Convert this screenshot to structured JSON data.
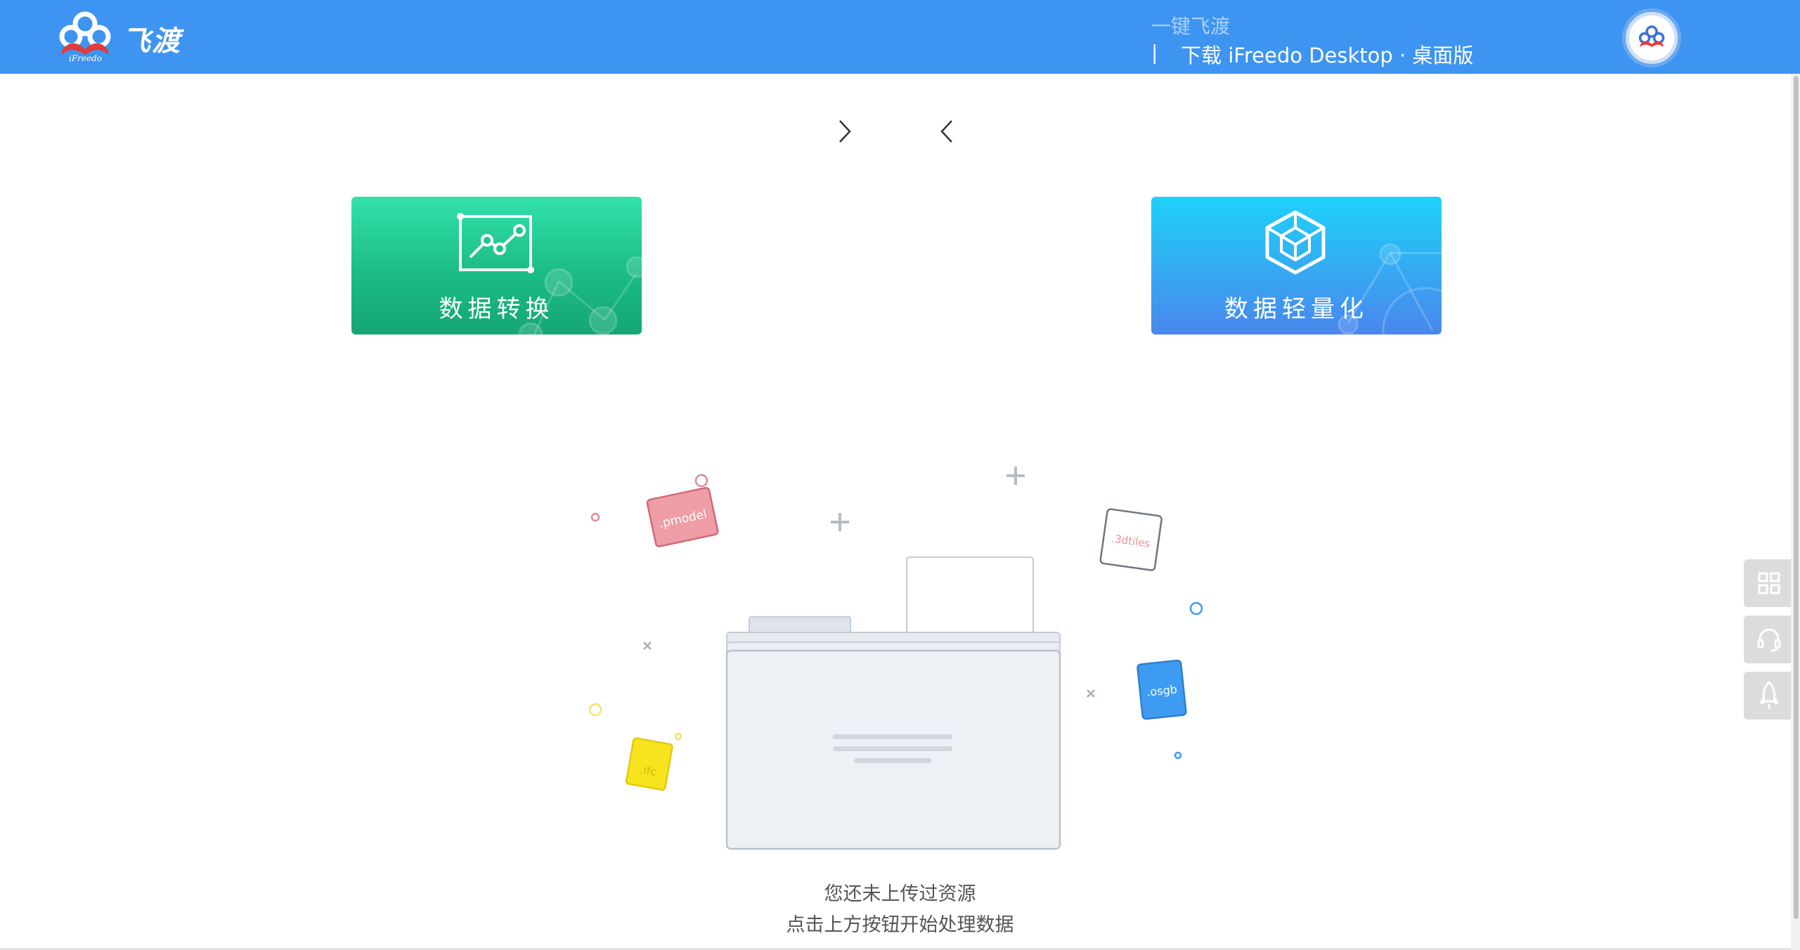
{
  "header": {
    "logo_text": "飞渡",
    "logo_subtext": "iFreedo",
    "tagline": "一键飞渡",
    "separator": "|",
    "download_label": "下载 iFreedo Desktop · 桌面版",
    "avatar_icon": "user-avatar-icon",
    "bg_color": "#3d94f1"
  },
  "carousel": {
    "next_icon": "chevron-right-icon",
    "prev_icon": "chevron-left-icon"
  },
  "cards": [
    {
      "label": "数据转换",
      "icon": "chart-line-icon",
      "color_top": "#33e1ab",
      "color_bottom": "#16a676"
    },
    {
      "label": "数据轻量化",
      "icon": "cube-icon",
      "color_top": "#1ed1fb",
      "color_bottom": "#4a86ec"
    }
  ],
  "empty_state": {
    "line1": "您还未上传过资源",
    "line2": "点击上方按钮开始处理数据",
    "file_tags": [
      {
        "label": ".pmodel",
        "color": "#ef9da6"
      },
      {
        "label": ".3dtiles",
        "color": "#ffffff"
      },
      {
        "label": ".osgb",
        "color": "#3d9cf1"
      },
      {
        "label": ".ifc",
        "color": "#f8e41c"
      }
    ]
  },
  "side_tools": [
    {
      "icon": "grid-apps-icon"
    },
    {
      "icon": "headset-icon"
    },
    {
      "icon": "rocket-icon"
    }
  ]
}
